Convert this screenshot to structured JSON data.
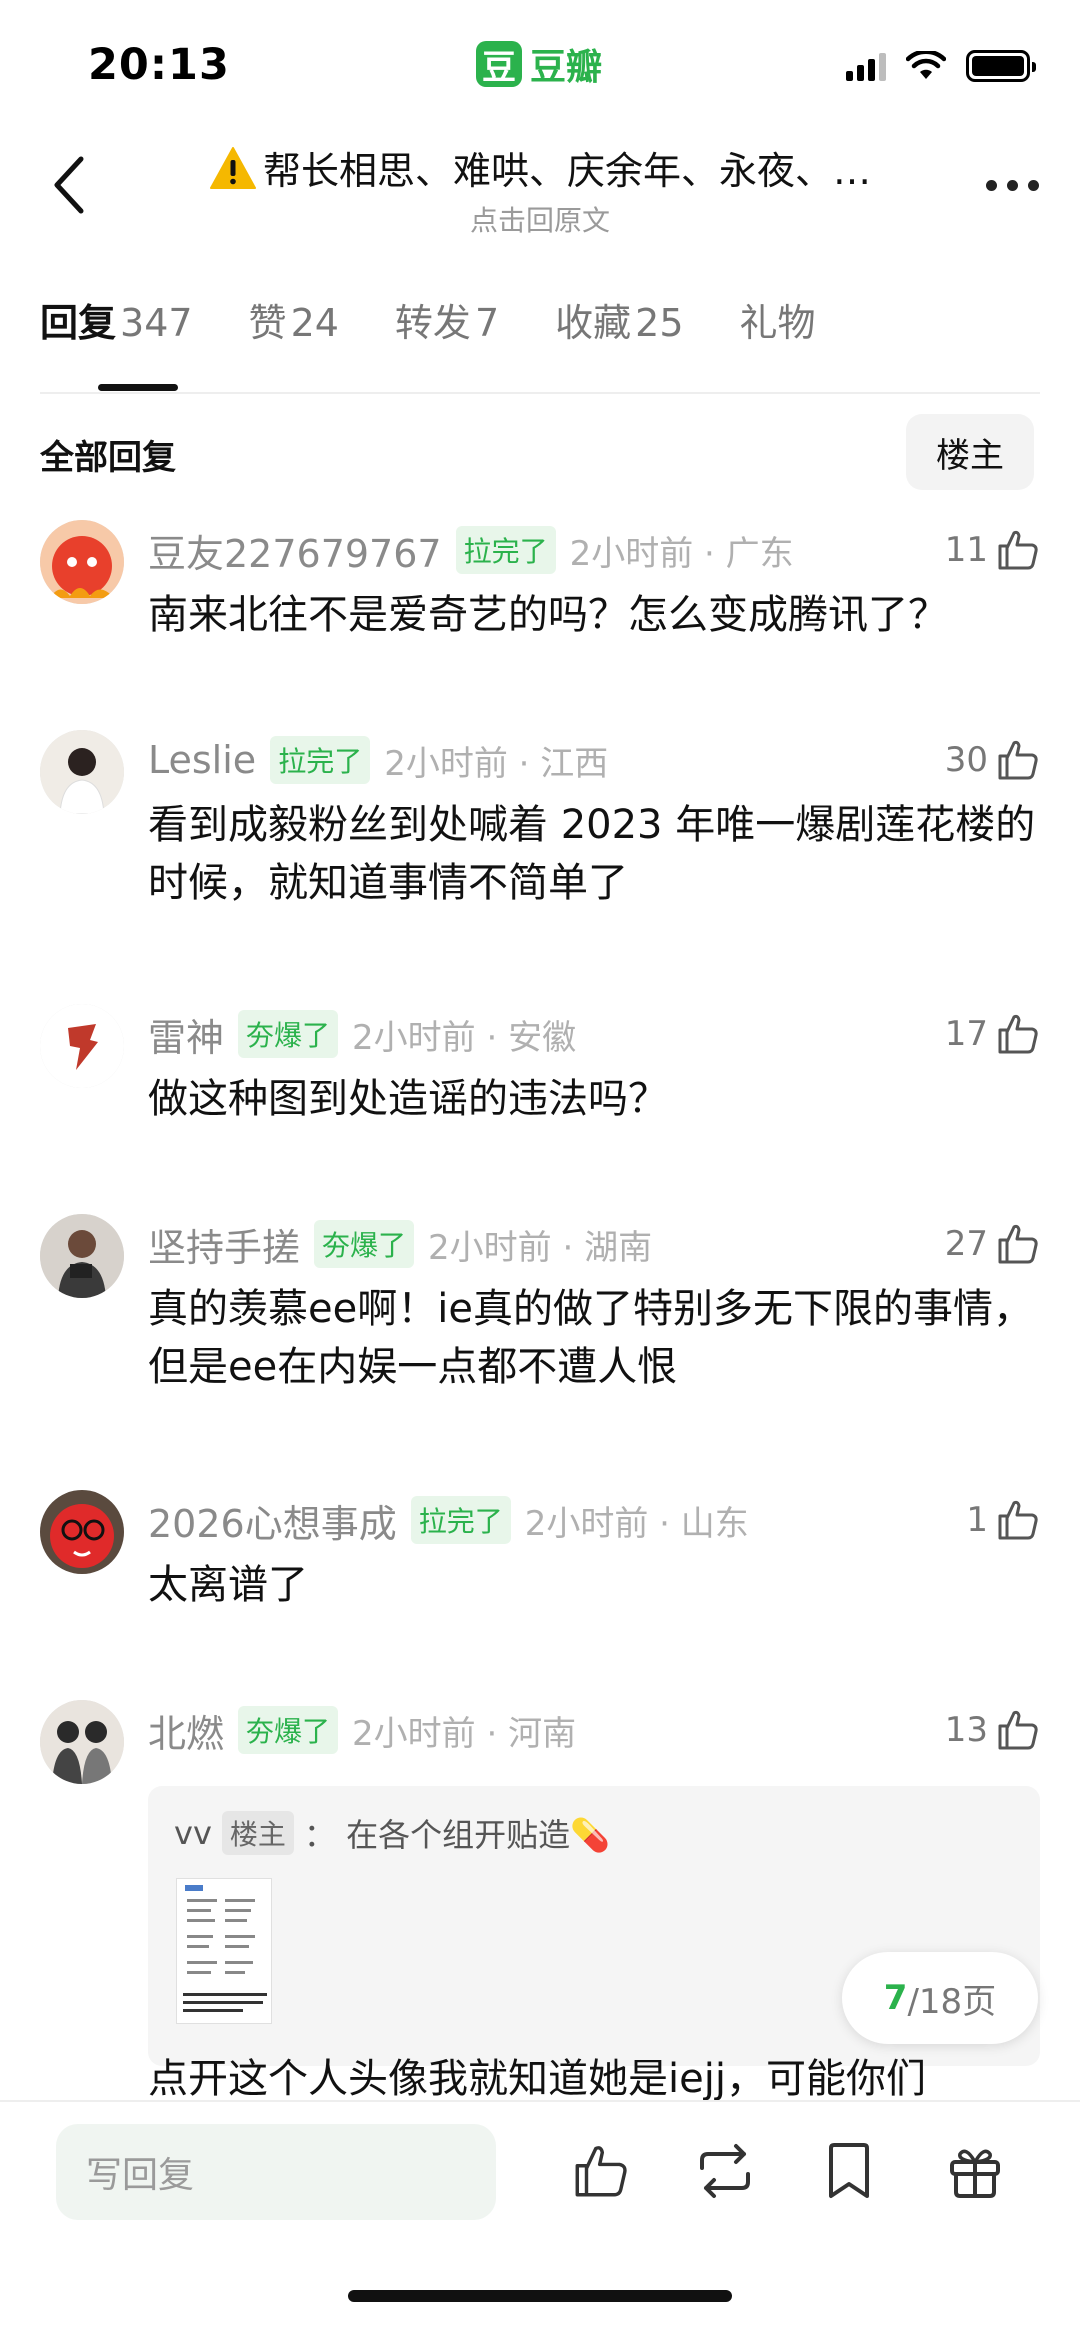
{
  "status_bar": {
    "time": "20:13",
    "app_logo_char": "豆",
    "app_name": "豆瓣"
  },
  "nav": {
    "title": "帮长相思、难哄、庆余年、永夜、…",
    "subtitle": "点击回原文"
  },
  "tabs": [
    {
      "label": "回复",
      "count": "347",
      "active": true
    },
    {
      "label": "赞",
      "count": "24"
    },
    {
      "label": "转发",
      "count": "7"
    },
    {
      "label": "收藏",
      "count": "25"
    },
    {
      "label": "礼物",
      "count": ""
    }
  ],
  "section": {
    "title": "全部回复",
    "filter": "楼主"
  },
  "comments": [
    {
      "name": "豆友227679767",
      "badge": "拉完了",
      "meta": "2小时前 · 广东",
      "likes": "11",
      "text": "南来北往不是爱奇艺的吗？怎么变成腾讯了？"
    },
    {
      "name": "Leslie",
      "badge": "拉完了",
      "meta": "2小时前 · 江西",
      "likes": "30",
      "text": "看到成毅粉丝到处喊着 2023 年唯一爆剧莲花楼的时候，就知道事情不简单了"
    },
    {
      "name": "雷神",
      "badge": "夯爆了",
      "meta": "2小时前 · 安徽",
      "likes": "17",
      "text": "做这种图到处造谣的违法吗？"
    },
    {
      "name": "坚持手搓",
      "badge": "夯爆了",
      "meta": "2小时前 · 湖南",
      "likes": "27",
      "text": "真的羡慕ee啊！ie真的做了特别多无下限的事情，但是ee在内娱一点都不遭人恨"
    },
    {
      "name": "2026心想事成",
      "badge": "拉完了",
      "meta": "2小时前 · 山东",
      "likes": "1",
      "text": "太离谱了"
    },
    {
      "name": "北燃",
      "badge": "夯爆了",
      "meta": "2小时前 · 河南",
      "likes": "13",
      "text": "点开这个人头像我就知道她是iejj，可能你们",
      "quote": {
        "user": "vv",
        "owner_tag": "楼主",
        "text": "： 在各个组开贴造💊"
      }
    }
  ],
  "page_indicator": {
    "current": "7",
    "total": "/18页"
  },
  "bottom": {
    "reply_placeholder": "写回复"
  },
  "colors": {
    "accent": "#2bb24c",
    "badge_bg": "#e8f6ea"
  },
  "icons": [
    "back-chevron-icon",
    "more-icon",
    "thumbs-up-icon",
    "repost-icon",
    "bookmark-icon",
    "gift-icon",
    "warning-icon"
  ]
}
